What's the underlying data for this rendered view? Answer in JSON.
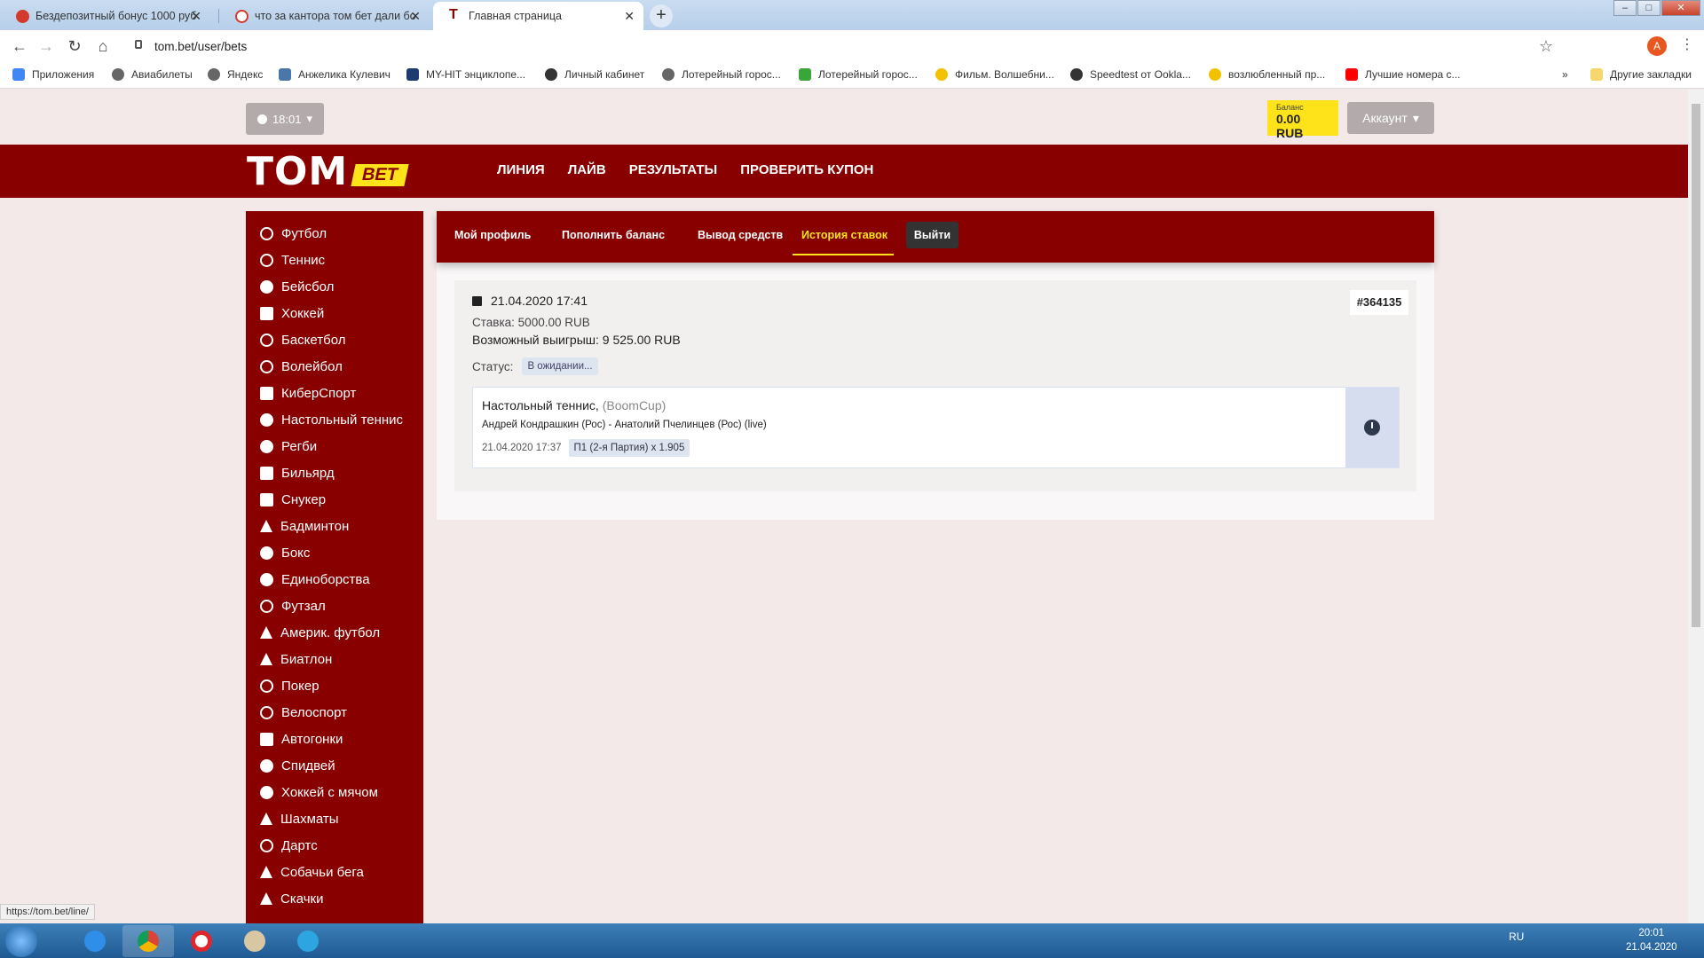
{
  "browser": {
    "tabs": [
      {
        "title": "Бездепозитный бонус 1000 руб",
        "favicon_color": "#d33a2c"
      },
      {
        "title": "что за кантора том бет дали бо",
        "favicon_color": "#d33a2c"
      },
      {
        "title": "Главная страница",
        "favicon_color": "#880000"
      }
    ],
    "url": "tom.bet/user/bets",
    "profile_initial": "A",
    "bookmarks": [
      {
        "label": "Приложения",
        "color": "#4285f4"
      },
      {
        "label": "Авиабилеты",
        "color": "#666666"
      },
      {
        "label": "Яндекс",
        "color": "#666666"
      },
      {
        "label": "Анжелика Кулевич",
        "color": "#4a76a8"
      },
      {
        "label": "MY-HIT энциклопе...",
        "color": "#1d3b6e"
      },
      {
        "label": "Личный кабинет",
        "color": "#333333"
      },
      {
        "label": "Лотерейный горос...",
        "color": "#666666"
      },
      {
        "label": "Лотерейный горос...",
        "color": "#3aa63a"
      },
      {
        "label": "Фильм. Волшебни...",
        "color": "#f2c200"
      },
      {
        "label": "Speedtest от Ookla...",
        "color": "#333333"
      },
      {
        "label": "возлюбленный пр...",
        "color": "#f2c200"
      },
      {
        "label": "Лучшие номера с...",
        "color": "#ff0000"
      }
    ],
    "bookmarks_more": "»",
    "other_bookmarks": "Другие закладки",
    "status_url": "https://tom.bet/line/"
  },
  "site": {
    "time": "18:01",
    "balance_label": "Баланс",
    "balance_value": "0.00 RUB",
    "account_label": "Аккаунт",
    "logo_text": "TOM",
    "logo_badge": "BET",
    "nav": [
      "ЛИНИЯ",
      "ЛАЙВ",
      "РЕЗУЛЬТАТЫ",
      "ПРОВЕРИТЬ КУПОН"
    ],
    "sports": [
      "Футбол",
      "Теннис",
      "Бейсбол",
      "Хоккей",
      "Баскетбол",
      "Волейбол",
      "КиберСпорт",
      "Настольный теннис",
      "Регби",
      "Бильярд",
      "Снукер",
      "Бадминтон",
      "Бокс",
      "Единоборства",
      "Футзал",
      "Америк. футбол",
      "Биатлон",
      "Покер",
      "Велоспорт",
      "Автогонки",
      "Спидвей",
      "Хоккей с мячом",
      "Шахматы",
      "Дартс",
      "Собачьи бега",
      "Скачки"
    ],
    "profile_nav": {
      "my_profile": "Мой профиль",
      "deposit": "Пополнить баланс",
      "withdraw": "Вывод средств",
      "history": "История ставок",
      "logout": "Выйти"
    },
    "bet": {
      "datetime": "21.04.2020 17:41",
      "id": "#364135",
      "stake": "Ставка: 5000.00 RUB",
      "possible_win": "Возможный выигрыш: 9 525.00 RUB",
      "status_label": "Статус:",
      "status_value": "В ожидании...",
      "event": {
        "sport": "Настольный теннис,",
        "tournament": "(BoomCup)",
        "teams": "Андрей Кондрашкин (Рос) - Анатолий Пчелинцев (Рос) (live)",
        "time": "21.04.2020 17:37",
        "selection": "П1 (2-я Партия) x 1.905"
      }
    }
  },
  "taskbar": {
    "lang": "RU",
    "time": "20:01",
    "date": "21.04.2020"
  }
}
